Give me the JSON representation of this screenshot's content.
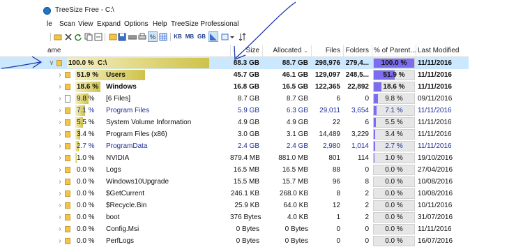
{
  "window": {
    "title": "TreeSize Free - C:\\"
  },
  "menu": [
    "le",
    "Scan",
    "View",
    "Expand",
    "Options",
    "Help",
    "TreeSize Professional"
  ],
  "toolbar": {
    "units": [
      "KB",
      "MB",
      "GB"
    ],
    "percent": "%"
  },
  "columns": {
    "name": "ame",
    "size": "Size",
    "allocated": "Allocated",
    "files": "Files",
    "folders": "Folders",
    "parent": "% of Parent...",
    "modified": "Last Modified"
  },
  "rows": [
    {
      "pct": "100.0 %",
      "name": "C:\\",
      "size": "88.3 GB",
      "allocated": "88.7 GB",
      "files": "298,976",
      "folders": "279,4...",
      "parent": "100.0 %",
      "parent_value": 100,
      "modified": "11/11/2016",
      "icon": "folder-icon",
      "expand": "down"
    },
    {
      "pct": "51.9 %",
      "name": "Users",
      "size": "45.7 GB",
      "allocated": "46.1 GB",
      "files": "129,097",
      "folders": "248,5...",
      "parent": "51.9 %",
      "parent_value": 51.9,
      "modified": "11/11/2016",
      "icon": "folder-icon",
      "expand": "right"
    },
    {
      "pct": "18.6 %",
      "name": "Windows",
      "size": "16.8 GB",
      "allocated": "16.5 GB",
      "files": "122,365",
      "folders": "22,892",
      "parent": "18.6 %",
      "parent_value": 18.6,
      "modified": "11/11/2016",
      "icon": "folder-icon",
      "expand": "right"
    },
    {
      "pct": "9.8 %",
      "name": "[6 Files]",
      "size": "8.7 GB",
      "allocated": "8.7 GB",
      "files": "6",
      "folders": "0",
      "parent": "9.8 %",
      "parent_value": 9.8,
      "modified": "09/11/2016",
      "icon": "file-icon",
      "expand": "right"
    },
    {
      "pct": "7.1 %",
      "name": "Program Files",
      "size": "5.9 GB",
      "allocated": "6.3 GB",
      "files": "29,011",
      "folders": "3,654",
      "parent": "7.1 %",
      "parent_value": 7.1,
      "modified": "11/11/2016",
      "icon": "folder-icon",
      "expand": "right"
    },
    {
      "pct": "5.5 %",
      "name": "System Volume Information",
      "size": "4.9 GB",
      "allocated": "4.9 GB",
      "files": "22",
      "folders": "6",
      "parent": "5.5 %",
      "parent_value": 5.5,
      "modified": "11/11/2016",
      "icon": "folder-icon",
      "expand": "right"
    },
    {
      "pct": "3.4 %",
      "name": "Program Files (x86)",
      "size": "3.0 GB",
      "allocated": "3.1 GB",
      "files": "14,489",
      "folders": "3,229",
      "parent": "3.4 %",
      "parent_value": 3.4,
      "modified": "11/11/2016",
      "icon": "folder-icon",
      "expand": "right"
    },
    {
      "pct": "2.7 %",
      "name": "ProgramData",
      "size": "2.4 GB",
      "allocated": "2.4 GB",
      "files": "2,980",
      "folders": "1,014",
      "parent": "2.7 %",
      "parent_value": 2.7,
      "modified": "11/11/2016",
      "icon": "folder-icon",
      "expand": "right"
    },
    {
      "pct": "1.0 %",
      "name": "NVIDIA",
      "size": "879.4 MB",
      "allocated": "881.0 MB",
      "files": "801",
      "folders": "114",
      "parent": "1.0 %",
      "parent_value": 1.0,
      "modified": "19/10/2016",
      "icon": "folder-icon",
      "expand": "right"
    },
    {
      "pct": "0.0 %",
      "name": "Logs",
      "size": "16.5 MB",
      "allocated": "16.5 MB",
      "files": "88",
      "folders": "0",
      "parent": "0.0 %",
      "parent_value": 0,
      "modified": "27/04/2016",
      "icon": "folder-icon",
      "expand": "right"
    },
    {
      "pct": "0.0 %",
      "name": "Windows10Upgrade",
      "size": "15.5 MB",
      "allocated": "15.7 MB",
      "files": "96",
      "folders": "8",
      "parent": "0.0 %",
      "parent_value": 0,
      "modified": "10/08/2016",
      "icon": "folder-icon",
      "expand": "right"
    },
    {
      "pct": "0.0 %",
      "name": "$GetCurrent",
      "size": "246.1 KB",
      "allocated": "268.0 KB",
      "files": "8",
      "folders": "2",
      "parent": "0.0 %",
      "parent_value": 0,
      "modified": "10/08/2016",
      "icon": "folder-icon",
      "expand": "right"
    },
    {
      "pct": "0.0 %",
      "name": "$Recycle.Bin",
      "size": "25.9 KB",
      "allocated": "64.0 KB",
      "files": "12",
      "folders": "2",
      "parent": "0.0 %",
      "parent_value": 0,
      "modified": "10/11/2016",
      "icon": "folder-icon",
      "expand": "right"
    },
    {
      "pct": "0.0 %",
      "name": "boot",
      "size": "376 Bytes",
      "allocated": "4.0 KB",
      "files": "1",
      "folders": "2",
      "parent": "0.0 %",
      "parent_value": 0,
      "modified": "31/07/2016",
      "icon": "folder-icon",
      "expand": "right"
    },
    {
      "pct": "0.0 %",
      "name": "Config.Msi",
      "size": "0 Bytes",
      "allocated": "0 Bytes",
      "files": "0",
      "folders": "0",
      "parent": "0.0 %",
      "parent_value": 0,
      "modified": "11/11/2016",
      "icon": "folder-icon",
      "expand": "right"
    },
    {
      "pct": "0.0 %",
      "name": "PerfLogs",
      "size": "0 Bytes",
      "allocated": "0 Bytes",
      "files": "0",
      "folders": "0",
      "parent": "0.0 %",
      "parent_value": 0,
      "modified": "16/07/2016",
      "icon": "folder-icon",
      "expand": "right"
    }
  ],
  "colors": {
    "selected_row": "#cce8ff",
    "bar_gradient_start": "#cfc24a",
    "bar_gradient_end": "#f5f0c0",
    "parent_fill": "#7b6cf0",
    "annotation": "#1a35a8"
  }
}
